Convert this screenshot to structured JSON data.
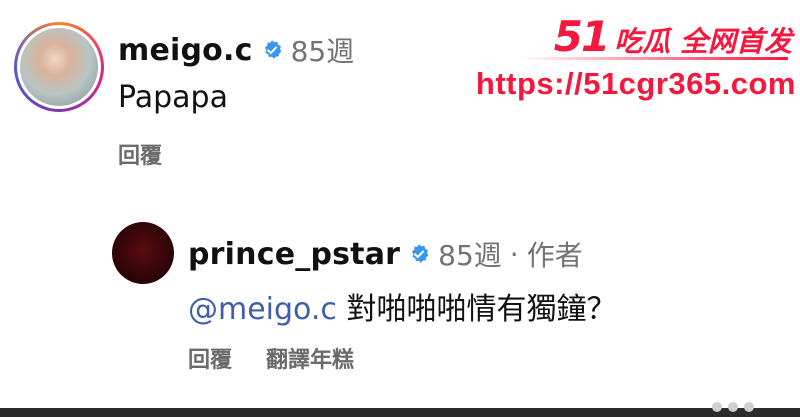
{
  "comments": [
    {
      "username": "meigo.c",
      "verified": true,
      "time": "85週",
      "author_tag": "",
      "mention": "",
      "text": "Papapa",
      "actions": [
        "回覆"
      ]
    },
    {
      "username": "prince_pstar",
      "verified": true,
      "time": "85週",
      "author_tag": "作者",
      "mention": "@meigo.c",
      "text": "對啪啪啪情有獨鐘？",
      "actions": [
        "回覆",
        "翻譯年糕"
      ]
    }
  ],
  "watermark": {
    "brand_number": "51",
    "brand_text": "吃瓜 全网首发",
    "url": "https://51cgr365.com"
  },
  "colors": {
    "verified": "#3897f0",
    "mention": "#3f5fa8",
    "meta": "#737373",
    "watermark": "#f5173d"
  },
  "icons": {
    "verified": "verified-badge-icon"
  }
}
